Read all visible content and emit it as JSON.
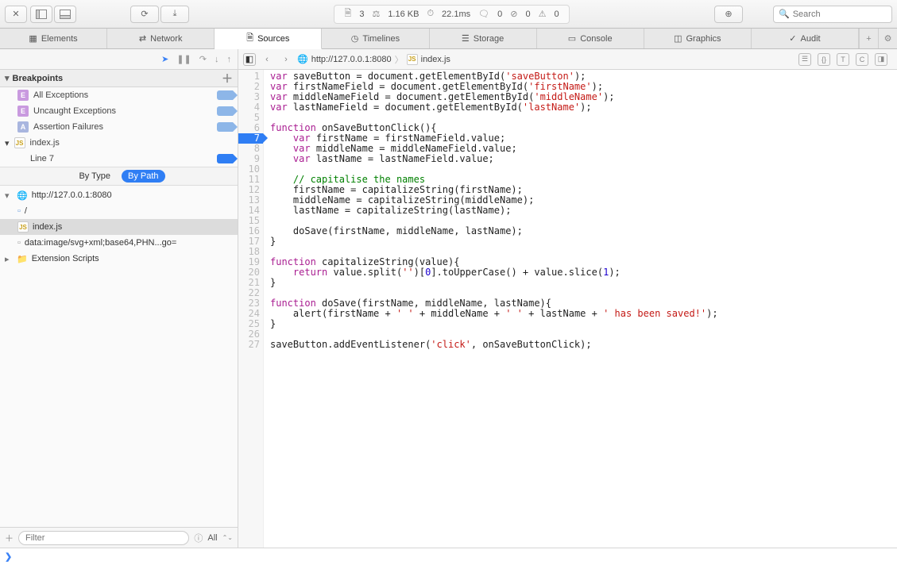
{
  "toolbar": {
    "resource_count": "3",
    "size": "1.16 KB",
    "time": "22.1ms",
    "log_count": "0",
    "error_count": "0",
    "warning_count": "0",
    "search_placeholder": "Search"
  },
  "tabs": [
    {
      "label": "Elements",
      "icon": "elements"
    },
    {
      "label": "Network",
      "icon": "network"
    },
    {
      "label": "Sources",
      "icon": "sources",
      "active": true
    },
    {
      "label": "Timelines",
      "icon": "timelines"
    },
    {
      "label": "Storage",
      "icon": "storage"
    },
    {
      "label": "Console",
      "icon": "console"
    },
    {
      "label": "Graphics",
      "icon": "graphics"
    },
    {
      "label": "Audit",
      "icon": "audit"
    }
  ],
  "breadcrumb": {
    "host": "http://127.0.0.1:8080",
    "file": "index.js"
  },
  "breakpoints": {
    "header": "Breakpoints",
    "items": [
      {
        "label": "All Exceptions",
        "badge": "E"
      },
      {
        "label": "Uncaught Exceptions",
        "badge": "E"
      },
      {
        "label": "Assertion Failures",
        "badge": "A"
      }
    ],
    "file": "index.js",
    "line_label": "Line 7"
  },
  "filter": {
    "by_type": "By Type",
    "by_path": "By Path"
  },
  "tree": {
    "host": "http://127.0.0.1:8080",
    "items": [
      {
        "label": "/",
        "icon": "doc"
      },
      {
        "label": "index.js",
        "icon": "js",
        "selected": true
      },
      {
        "label": "data:image/svg+xml;base64,PHN...go=",
        "icon": "img"
      }
    ],
    "folder": "Extension Scripts"
  },
  "bottom_filter": {
    "placeholder": "Filter",
    "all": "All"
  },
  "code_lines": [
    [
      [
        "kw",
        "var"
      ],
      [
        "",
        " saveButton = document.getElementById("
      ],
      [
        "str",
        "'saveButton'"
      ],
      [
        "",
        ");"
      ]
    ],
    [
      [
        "kw",
        "var"
      ],
      [
        "",
        " firstNameField = document.getElementById("
      ],
      [
        "str",
        "'firstName'"
      ],
      [
        "",
        ");"
      ]
    ],
    [
      [
        "kw",
        "var"
      ],
      [
        "",
        " middleNameField = document.getElementById("
      ],
      [
        "str",
        "'middleName'"
      ],
      [
        "",
        ");"
      ]
    ],
    [
      [
        "kw",
        "var"
      ],
      [
        "",
        " lastNameField = document.getElementById("
      ],
      [
        "str",
        "'lastName'"
      ],
      [
        "",
        ");"
      ]
    ],
    [],
    [
      [
        "kw",
        "function"
      ],
      [
        "",
        " onSaveButtonClick(){"
      ]
    ],
    [
      [
        "",
        "    "
      ],
      [
        "kw",
        "var"
      ],
      [
        "",
        " firstName = firstNameField.value;"
      ]
    ],
    [
      [
        "",
        "    "
      ],
      [
        "kw",
        "var"
      ],
      [
        "",
        " middleName = middleNameField.value;"
      ]
    ],
    [
      [
        "",
        "    "
      ],
      [
        "kw",
        "var"
      ],
      [
        "",
        " lastName = lastNameField.value;"
      ]
    ],
    [],
    [
      [
        "",
        "    "
      ],
      [
        "com",
        "// capitalise the names"
      ]
    ],
    [
      [
        "",
        "    firstName = capitalizeString(firstName);"
      ]
    ],
    [
      [
        "",
        "    middleName = capitalizeString(middleName);"
      ]
    ],
    [
      [
        "",
        "    lastName = capitalizeString(lastName);"
      ]
    ],
    [],
    [
      [
        "",
        "    doSave(firstName, middleName, lastName);"
      ]
    ],
    [
      [
        "",
        "}"
      ]
    ],
    [],
    [
      [
        "kw",
        "function"
      ],
      [
        "",
        " capitalizeString(value){"
      ]
    ],
    [
      [
        "",
        "    "
      ],
      [
        "kw",
        "return"
      ],
      [
        "",
        " value.split("
      ],
      [
        "str",
        "''"
      ],
      [
        "",
        ")["
      ],
      [
        "num",
        "0"
      ],
      [
        "",
        "].toUpperCase() + value.slice("
      ],
      [
        "num",
        "1"
      ],
      [
        "",
        ");"
      ]
    ],
    [
      [
        "",
        "}"
      ]
    ],
    [],
    [
      [
        "kw",
        "function"
      ],
      [
        "",
        " doSave(firstName, middleName, lastName){"
      ]
    ],
    [
      [
        "",
        "    alert(firstName + "
      ],
      [
        "str",
        "' '"
      ],
      [
        "",
        " + middleName + "
      ],
      [
        "str",
        "' '"
      ],
      [
        "",
        " + lastName + "
      ],
      [
        "str",
        "' has been saved!'"
      ],
      [
        "",
        ");"
      ]
    ],
    [
      [
        "",
        "}"
      ]
    ],
    [],
    [
      [
        "",
        "saveButton.addEventListener("
      ],
      [
        "str",
        "'click'"
      ],
      [
        "",
        ", onSaveButtonClick);"
      ]
    ]
  ],
  "breakpoint_line": 7,
  "console_prompt": "❯"
}
